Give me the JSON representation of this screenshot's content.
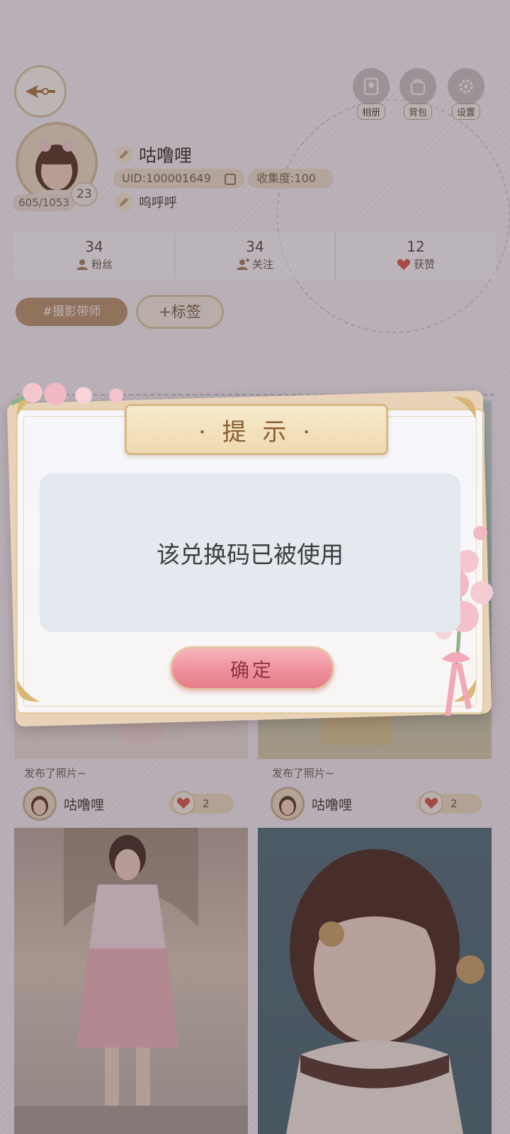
{
  "header": {
    "icons": [
      {
        "name": "album",
        "label": "相册"
      },
      {
        "name": "backpack",
        "label": "背包"
      },
      {
        "name": "settings",
        "label": "设置"
      }
    ]
  },
  "profile": {
    "username": "咕噜哩",
    "uid": "UID:100001649",
    "collection": "收集度:100",
    "signature": "呜呼呼",
    "level": "23",
    "exp": "605/1053"
  },
  "stats": [
    {
      "value": "34",
      "label": "粉丝"
    },
    {
      "value": "34",
      "label": "关注"
    },
    {
      "value": "12",
      "label": "获赞"
    }
  ],
  "tags": {
    "tag": "#摄影带师",
    "add": "+标签"
  },
  "posts": [
    {
      "caption": "发布了照片~",
      "user": "咕噜哩",
      "likes": "2"
    },
    {
      "caption": "发布了照片~",
      "user": "咕噜哩",
      "likes": "2"
    }
  ],
  "dialog": {
    "title": "· 提 示 ·",
    "message": "该兑换码已被使用",
    "confirm": "确定"
  }
}
